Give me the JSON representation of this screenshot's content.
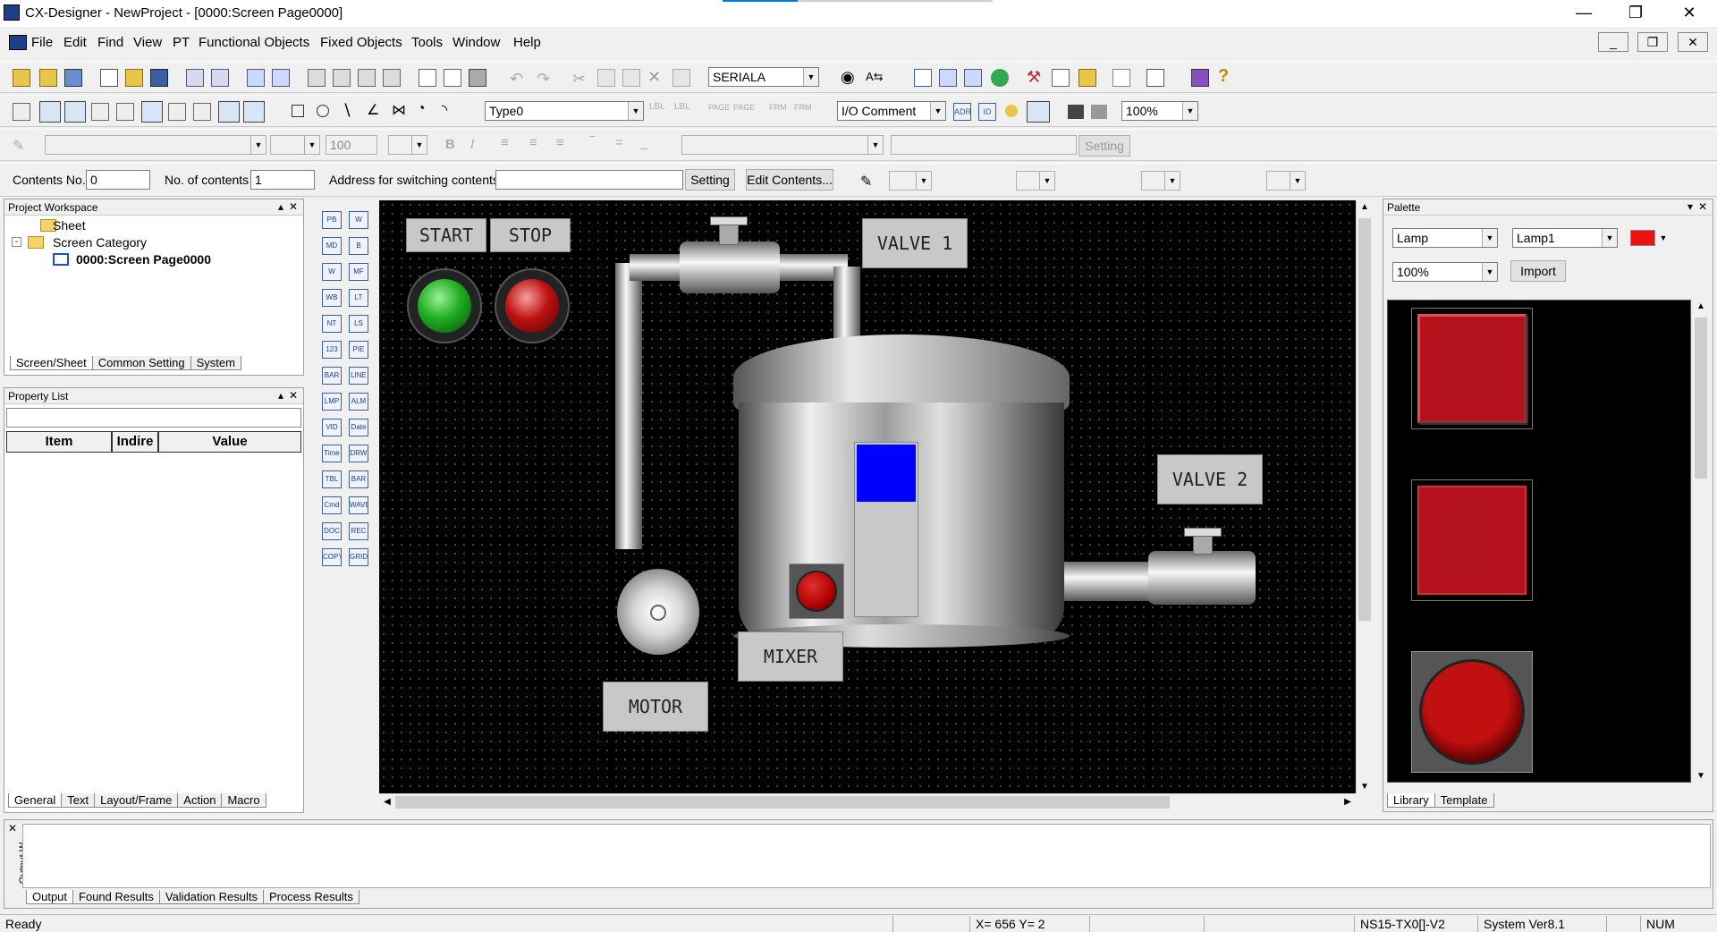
{
  "window": {
    "title": "CX-Designer - NewProject - [0000:Screen Page0000]"
  },
  "menu": [
    "File",
    "Edit",
    "Find",
    "View",
    "PT",
    "Functional Objects",
    "Fixed Objects",
    "Tools",
    "Window",
    "Help"
  ],
  "toolbar1": {
    "comm_port": "SERIALA"
  },
  "toolbar2": {
    "type_select": "Type0",
    "display_select": "I/O Comment",
    "zoom": "100%"
  },
  "toolbar3": {
    "font_size": "100",
    "setting_label": "Setting"
  },
  "toolbar4": {
    "contents_no_label": "Contents No.",
    "contents_no_value": "0",
    "no_of_contents_label": "No. of contents",
    "no_of_contents_value": "1",
    "address_label": "Address for switching contents",
    "address_value": "",
    "setting_button": "Setting",
    "edit_contents_button": "Edit Contents..."
  },
  "project_workspace": {
    "title": "Project Workspace",
    "tree": [
      {
        "label": "Sheet",
        "level": 1
      },
      {
        "label": "Screen Category",
        "level": 1
      },
      {
        "label": "0000:Screen Page0000",
        "level": 2
      }
    ],
    "tabs": [
      "Screen/Sheet",
      "Common Setting",
      "System"
    ]
  },
  "property_list": {
    "title": "Property List",
    "columns": [
      "Item",
      "Indire",
      "Value"
    ],
    "tabs": [
      "General",
      "Text",
      "Layout/Frame",
      "Action",
      "Macro"
    ]
  },
  "object_palette": [
    [
      "PB",
      "W"
    ],
    [
      "MD",
      "B"
    ],
    [
      "W",
      "MF"
    ],
    [
      "WB",
      "LT"
    ],
    [
      "NT",
      "LS"
    ],
    [
      "123",
      "PIE"
    ],
    [
      "BAR",
      "LINE"
    ],
    [
      "LMP",
      "ALM"
    ],
    [
      "VID",
      "Date"
    ],
    [
      "Time",
      "DRW"
    ],
    [
      "TBL",
      "BAR"
    ],
    [
      "Cmd",
      "WAVE"
    ],
    [
      "DOC",
      "REC"
    ],
    [
      "COPY",
      "GRID"
    ]
  ],
  "screen": {
    "start_label": "START",
    "stop_label": "STOP",
    "valve1_label": "VALVE 1",
    "valve2_label": "VALVE 2",
    "mixer_label": "MIXER",
    "motor_label": "MOTOR",
    "colors": {
      "start_lamp": "#1fae1f",
      "stop_lamp": "#c01010",
      "level_indicator": "#0000ff",
      "mixer_lamp": "#b00000"
    }
  },
  "palette": {
    "title": "Palette",
    "category": "Lamp",
    "item": "Lamp1",
    "zoom": "100%",
    "import_button": "Import",
    "color": "#ee1111",
    "tabs": [
      "Library",
      "Template"
    ]
  },
  "output": {
    "side_label": "Output W",
    "tabs": [
      "Output",
      "Found Results",
      "Validation Results",
      "Process Results"
    ]
  },
  "status": {
    "left": "Ready",
    "coords": "X= 656 Y=  2",
    "pt_model": "NS15-TX0[]-V2",
    "system": "System Ver8.1",
    "num": "NUM"
  }
}
